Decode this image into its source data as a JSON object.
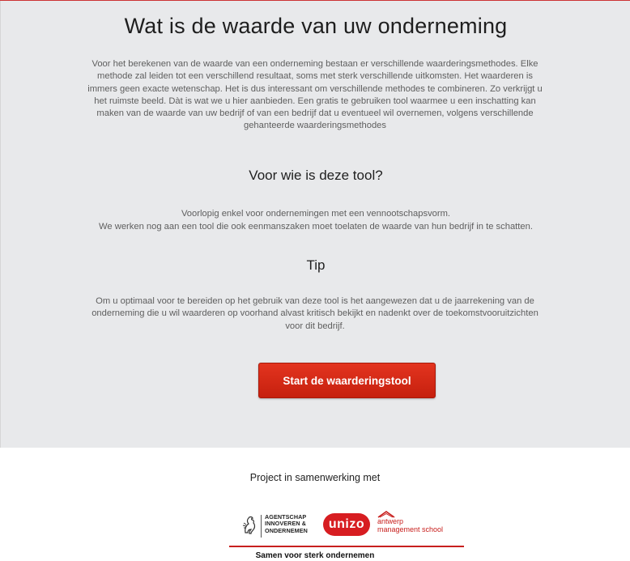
{
  "main": {
    "title": "Wat is de waarde van uw onderneming",
    "intro": "Voor het berekenen van de waarde van een onderneming bestaan er verschillende waarderingsmethodes. Elke methode zal leiden tot een verschillend resultaat, soms met sterk verschillende uitkomsten. Het waarderen is immers geen exacte wetenschap. Het is dus interessant om verschillende methodes te combineren. Zo verkrijgt u het ruimste beeld. Dàt is wat we u hier aanbieden. Een gratis te gebruiken tool waarmee u een inschatting kan maken van de waarde van uw bedrijf of van een bedrijf dat u eventueel wil overnemen, volgens verschillende gehanteerde waarderingsmethodes",
    "audience": {
      "title": "Voor wie is deze tool?",
      "line1": "Voorlopig enkel voor ondernemingen met een vennootschapsvorm.",
      "line2": "We werken nog aan een tool die ook eenmanszaken moet toelaten de waarde van hun bedrijf in te schatten."
    },
    "tip": {
      "title": "Tip",
      "text": "Om u optimaal voor te bereiden op het gebruik van deze tool is het aangewezen dat u de jaarrekening van de onderneming die u wil waarderen op voorhand alvast kritisch bekijkt en nadenkt over de toekomstvooruitzichten voor dit bedrijf."
    },
    "start_button": "Start de waarderingstool"
  },
  "footer": {
    "heading": "Project in samenwerking met",
    "partners": {
      "agentschap": [
        "AGENTSCHAP",
        "INNOVEREN &",
        "ONDERNEMEN"
      ],
      "unizo": "unizo",
      "ams": [
        "antwerp",
        "management school"
      ]
    },
    "tagline": "Samen voor sterk ondernemen"
  },
  "colors": {
    "accent": "#d42a17",
    "background": "#e8e9eb"
  }
}
